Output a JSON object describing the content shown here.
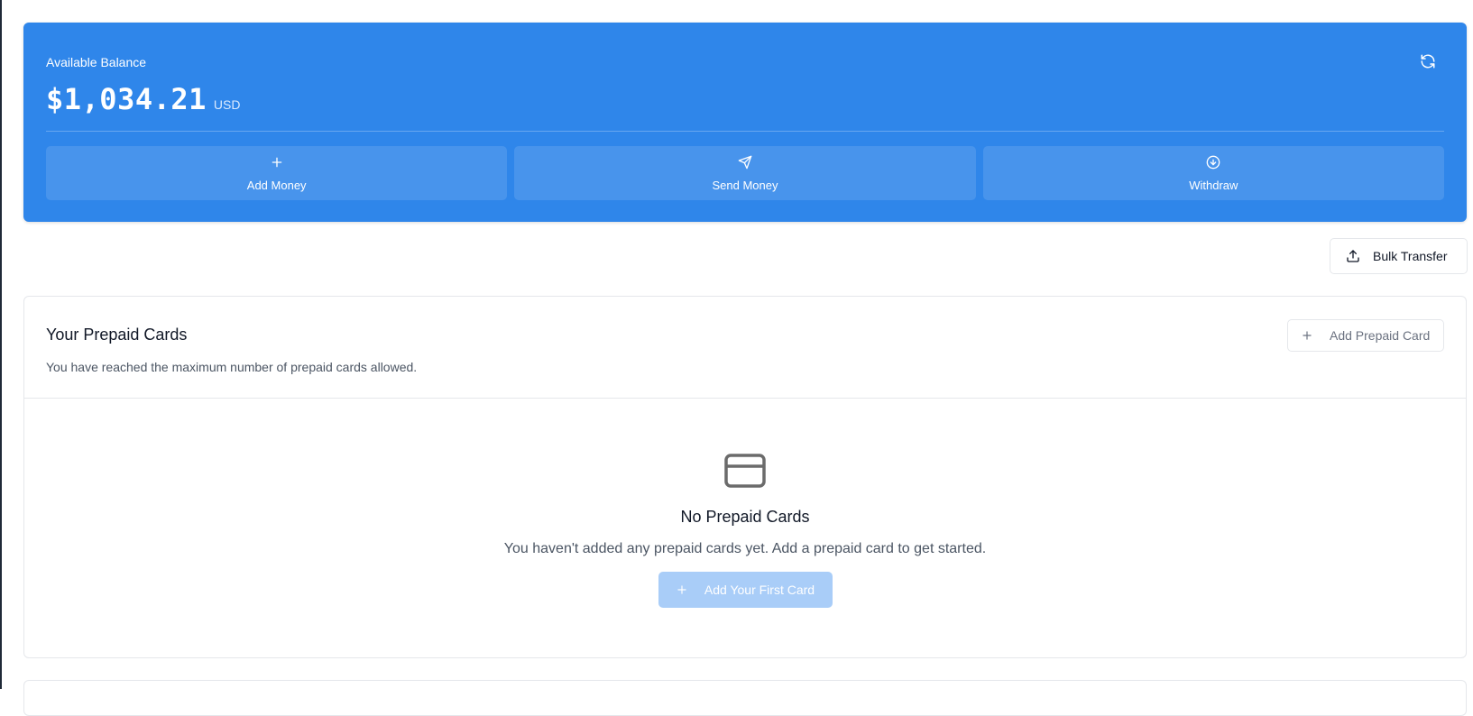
{
  "balance": {
    "label": "Available Balance",
    "amount": "$1,034.21",
    "currency": "USD",
    "refresh_icon": "refresh-icon",
    "accent_color": "#2f86ea"
  },
  "actions": [
    {
      "label": "Add Money",
      "icon": "plus-icon"
    },
    {
      "label": "Send Money",
      "icon": "send-icon"
    },
    {
      "label": "Withdraw",
      "icon": "arrow-down-circle-icon"
    }
  ],
  "bulk_transfer": {
    "label": "Bulk Transfer",
    "icon": "upload-icon"
  },
  "prepaid_cards": {
    "title": "Your Prepaid Cards",
    "subtitle": "You have reached the maximum number of prepaid cards allowed.",
    "add_button": {
      "label": "Add Prepaid Card",
      "icon": "plus-icon"
    },
    "empty": {
      "icon": "credit-card-icon",
      "title": "No Prepaid Cards",
      "text": "You haven't added any prepaid cards yet. Add a prepaid card to get started.",
      "button": {
        "label": "Add Your First Card",
        "icon": "plus-icon"
      }
    }
  }
}
